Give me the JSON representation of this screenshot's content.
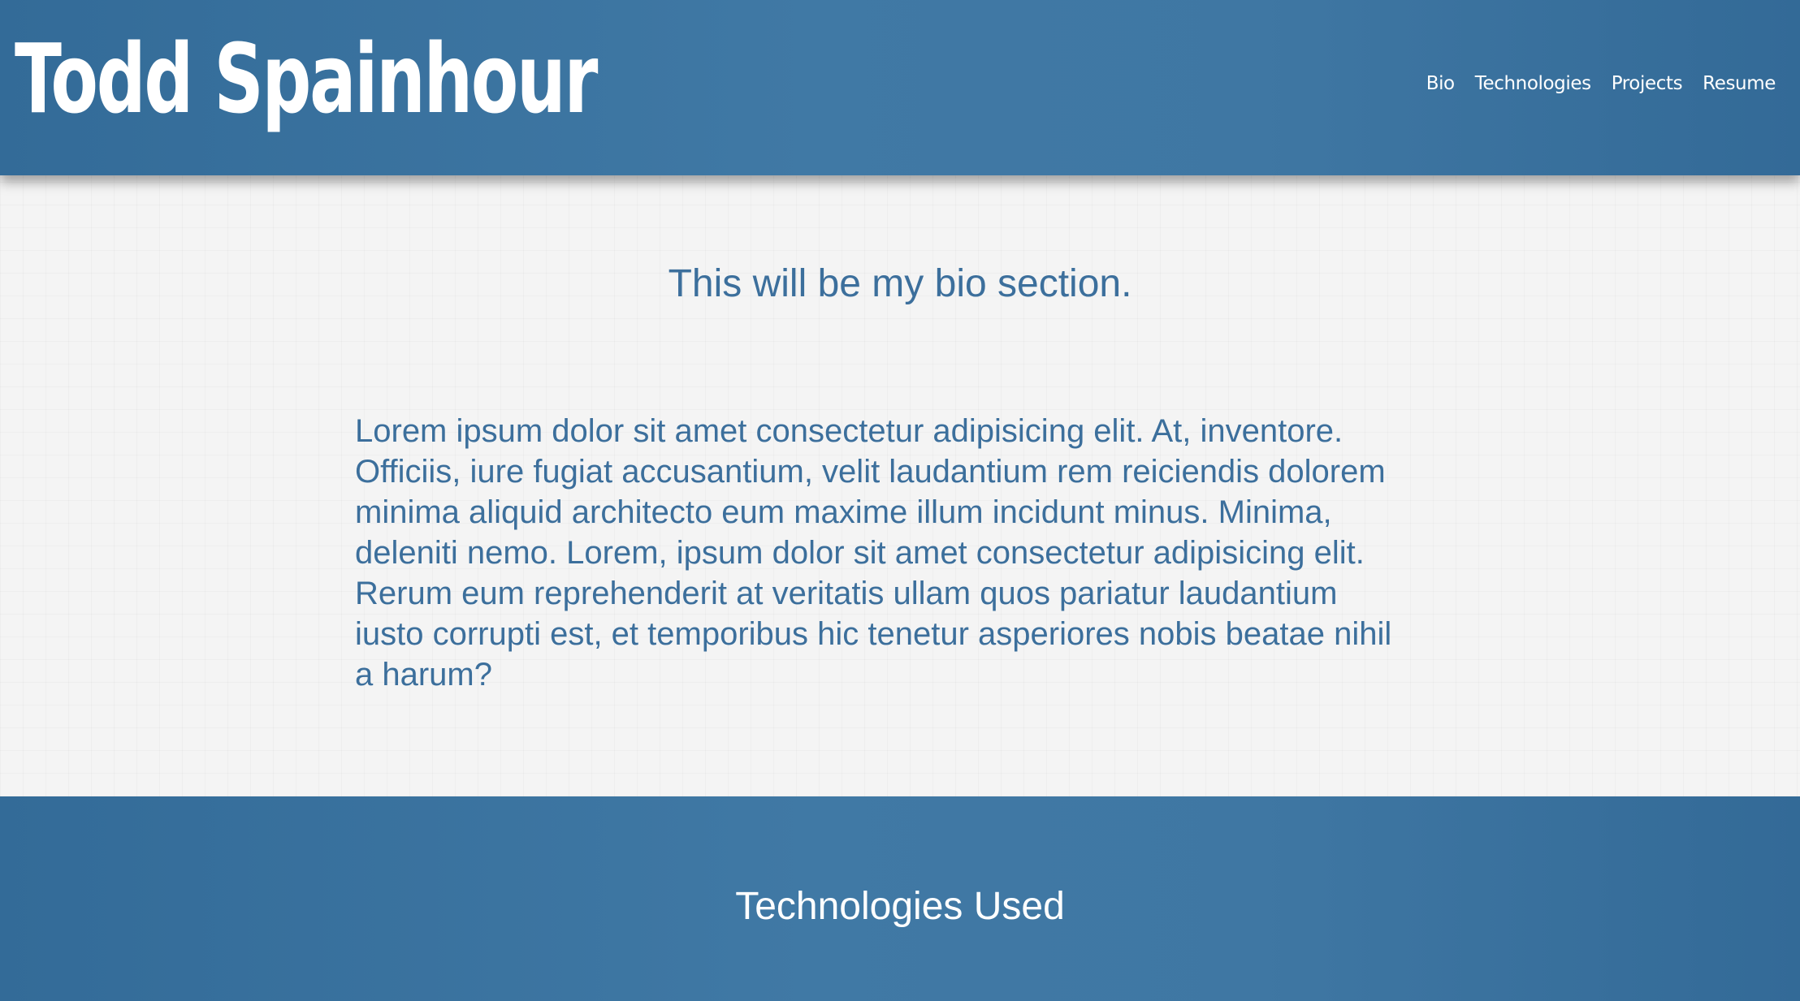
{
  "header": {
    "site_title": "Todd Spainhour",
    "nav": [
      {
        "label": "Bio"
      },
      {
        "label": "Technologies"
      },
      {
        "label": "Projects"
      },
      {
        "label": "Resume"
      }
    ]
  },
  "bio": {
    "title": "This will be my bio section.",
    "text": "Lorem ipsum dolor sit amet consectetur adipisicing elit. At, inventore. Officiis, iure fugiat accusantium, velit laudantium rem reiciendis dolorem minima aliquid architecto eum maxime illum incidunt minus. Minima, deleniti nemo. Lorem, ipsum dolor sit amet consectetur adipisicing elit. Rerum eum reprehenderit at veritatis ullam quos pariatur laudantium iusto corrupti est, et temporibus hic tenetur asperiores nobis beatae nihil a harum?"
  },
  "technologies": {
    "title": "Technologies Used"
  },
  "colors": {
    "brand_blue": "#3d74a1",
    "text_blue": "#3c6f9c",
    "background": "#f4f4f4",
    "white": "#ffffff"
  }
}
